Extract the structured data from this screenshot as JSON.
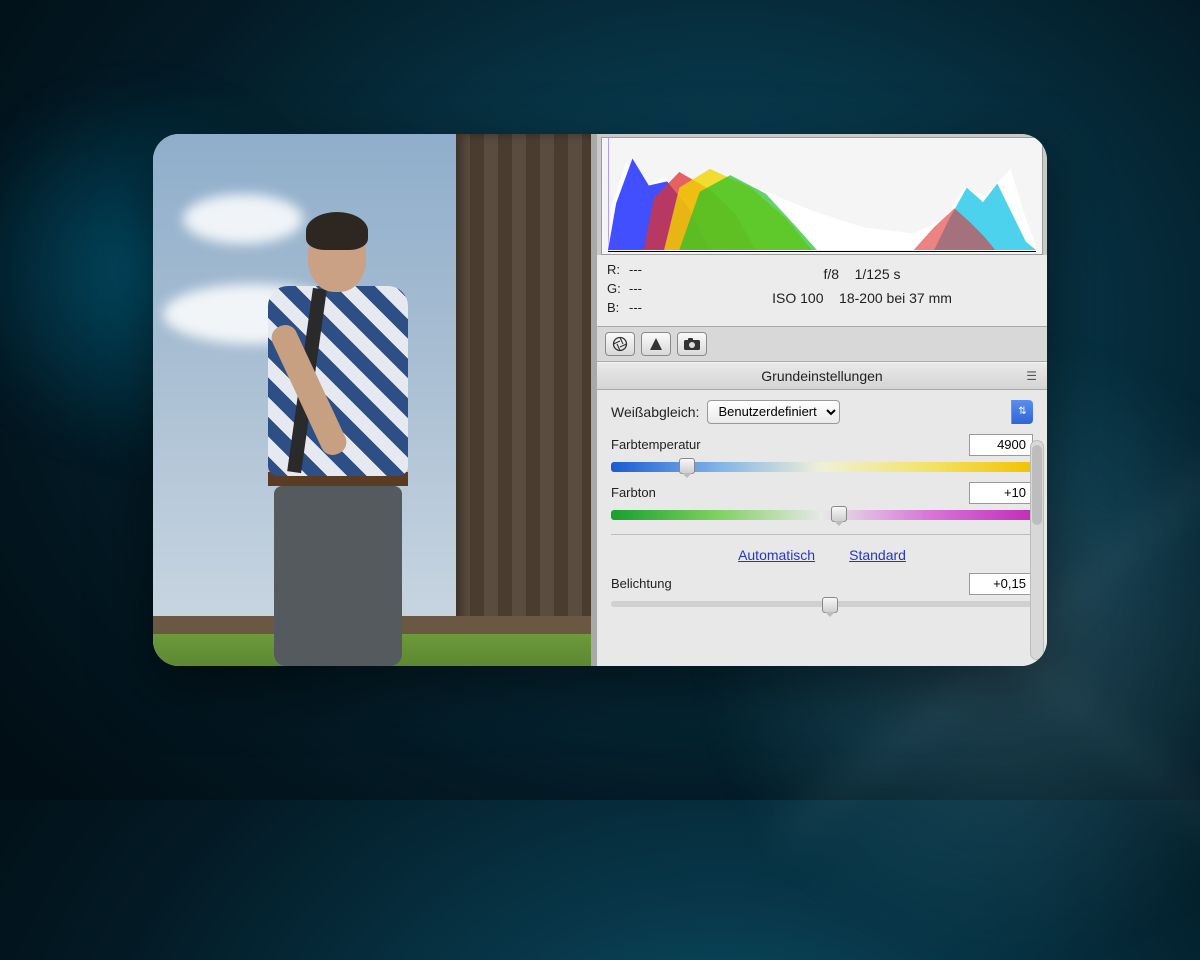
{
  "rgb": {
    "r_label": "R:",
    "g_label": "G:",
    "b_label": "B:",
    "r": "---",
    "g": "---",
    "b": "---"
  },
  "camera": {
    "aperture": "f/8",
    "shutter": "1/125 s",
    "iso": "ISO 100",
    "lens": "18-200 bei 37 mm"
  },
  "section": {
    "title": "Grundeinstellungen"
  },
  "wb": {
    "label": "Weißabgleich:",
    "selected": "Benutzerdefiniert"
  },
  "sliders": {
    "temperature": {
      "label": "Farbtemperatur",
      "value": "4900",
      "pos": 18
    },
    "tint": {
      "label": "Farbton",
      "value": "+10",
      "pos": 54
    },
    "exposure": {
      "label": "Belichtung",
      "value": "+0,15",
      "pos": 52
    }
  },
  "links": {
    "auto": "Automatisch",
    "default": "Standard"
  }
}
